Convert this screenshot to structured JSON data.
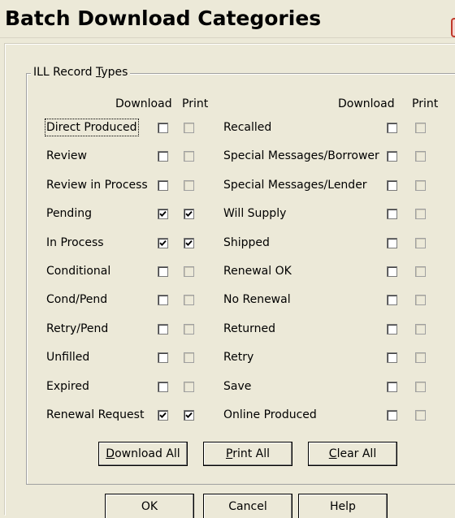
{
  "window": {
    "title": "Batch Download Categories"
  },
  "group": {
    "label_pre": "ILL Record ",
    "label_accel": "T",
    "label_post": "ypes"
  },
  "columns": {
    "download": "Download",
    "print": "Print"
  },
  "left_records": [
    {
      "label": "Direct Produced",
      "download": false,
      "print": false,
      "download_enabled": true,
      "print_enabled": false
    },
    {
      "label": "Review",
      "download": false,
      "print": false,
      "download_enabled": true,
      "print_enabled": false
    },
    {
      "label": "Review in Process",
      "download": false,
      "print": false,
      "download_enabled": true,
      "print_enabled": false
    },
    {
      "label": "Pending",
      "download": true,
      "print": true,
      "download_enabled": true,
      "print_enabled": true
    },
    {
      "label": "In Process",
      "download": true,
      "print": true,
      "download_enabled": true,
      "print_enabled": true
    },
    {
      "label": "Conditional",
      "download": false,
      "print": false,
      "download_enabled": true,
      "print_enabled": false
    },
    {
      "label": "Cond/Pend",
      "download": false,
      "print": false,
      "download_enabled": true,
      "print_enabled": false
    },
    {
      "label": "Retry/Pend",
      "download": false,
      "print": false,
      "download_enabled": true,
      "print_enabled": false
    },
    {
      "label": "Unfilled",
      "download": false,
      "print": false,
      "download_enabled": true,
      "print_enabled": false
    },
    {
      "label": "Expired",
      "download": false,
      "print": false,
      "download_enabled": true,
      "print_enabled": false
    },
    {
      "label": "Renewal Request",
      "download": true,
      "print": true,
      "download_enabled": true,
      "print_enabled": true
    }
  ],
  "right_records": [
    {
      "label": "Recalled",
      "download": false,
      "print": false,
      "download_enabled": true,
      "print_enabled": false
    },
    {
      "label": "Special Messages/Borrower",
      "download": false,
      "print": false,
      "download_enabled": true,
      "print_enabled": false
    },
    {
      "label": "Special Messages/Lender",
      "download": false,
      "print": false,
      "download_enabled": true,
      "print_enabled": false
    },
    {
      "label": "Will Supply",
      "download": false,
      "print": false,
      "download_enabled": true,
      "print_enabled": false
    },
    {
      "label": "Shipped",
      "download": false,
      "print": false,
      "download_enabled": true,
      "print_enabled": false
    },
    {
      "label": "Renewal OK",
      "download": false,
      "print": false,
      "download_enabled": true,
      "print_enabled": false
    },
    {
      "label": "No Renewal",
      "download": false,
      "print": false,
      "download_enabled": true,
      "print_enabled": false
    },
    {
      "label": "Returned",
      "download": false,
      "print": false,
      "download_enabled": true,
      "print_enabled": false
    },
    {
      "label": "Retry",
      "download": false,
      "print": false,
      "download_enabled": true,
      "print_enabled": false
    },
    {
      "label": "Save",
      "download": false,
      "print": false,
      "download_enabled": true,
      "print_enabled": false
    },
    {
      "label": "Online Produced",
      "download": false,
      "print": false,
      "download_enabled": true,
      "print_enabled": false
    }
  ],
  "actions": {
    "download_all": {
      "accel": "D",
      "rest": "ownload All"
    },
    "print_all": {
      "accel": "P",
      "rest": "rint All"
    },
    "clear_all": {
      "accel": "C",
      "rest": "lear All"
    }
  },
  "dialog_buttons": {
    "ok": "OK",
    "cancel": "Cancel",
    "help": "Help"
  },
  "colors": {
    "face": "#ece9d8",
    "title_edge": "#c0392b"
  }
}
